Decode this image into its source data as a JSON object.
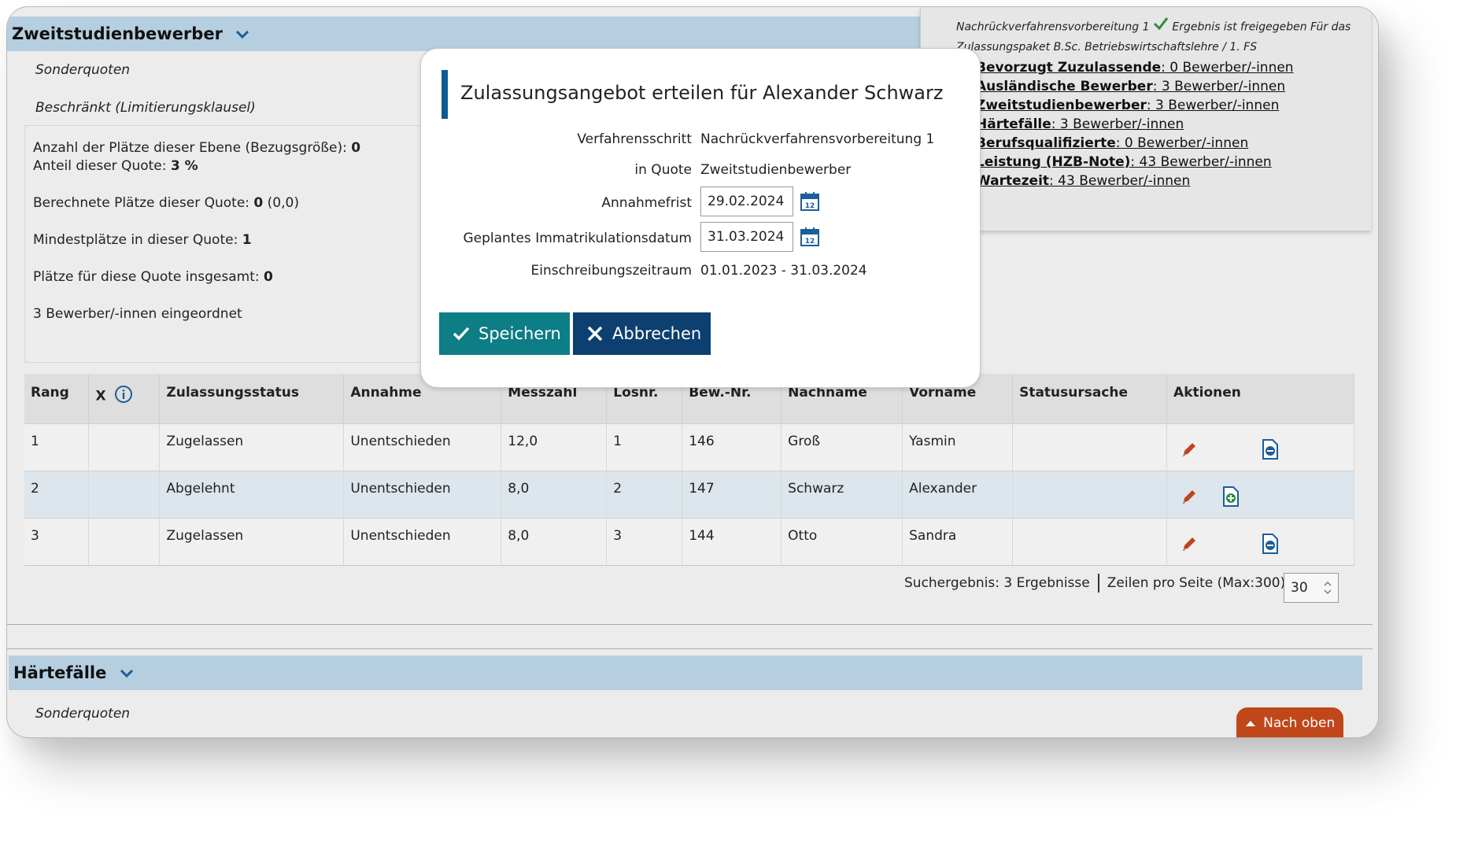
{
  "section1": {
    "title": "Zweitstudienbewerber",
    "sonderquoten": "Sonderquoten",
    "beschraenkt": "Beschränkt (Limitierungsklausel)",
    "info": {
      "plaetze_label": "Anzahl der Plätze dieser Ebene (Bezugsgröße): ",
      "plaetze_value": "0",
      "anteil_label": "Anteil dieser Quote: ",
      "anteil_value": "3 %",
      "berechnet_label": "Berechnete Plätze dieser Quote: ",
      "berechnet_value": "0",
      "berechnet_extra": " (0,0)",
      "mindest_label": "Mindestplätze in dieser Quote: ",
      "mindest_value": "1",
      "insgesamt_label": "Plätze für diese Quote insgesamt: ",
      "insgesamt_value": "0",
      "eingeordnet": "3 Bewerber/-innen eingeordnet"
    }
  },
  "right_panel": {
    "head_part1": "Nachrückverfahrensvorbereitung 1",
    "head_part2": "Ergebnis ist freigegeben Für das",
    "head_line2": "Zulassungspaket B.Sc. Betriebswirtschaftslehre / 1. FS",
    "items": [
      {
        "name": "Bevorzugt Zuzulassende",
        "count": ": 0 Bewerber/-innen"
      },
      {
        "name": "Ausländische Bewerber",
        "count": ": 3 Bewerber/-innen"
      },
      {
        "name": "Zweitstudienbewerber",
        "count": ": 3 Bewerber/-innen"
      },
      {
        "name": "Härtefälle",
        "count": ": 3 Bewerber/-innen"
      },
      {
        "name": "Berufsqualifizierte",
        "count": ": 0 Bewerber/-innen"
      },
      {
        "name": "Leistung (HZB-Note)",
        "count": ": 43 Bewerber/-innen"
      },
      {
        "name": "Wartezeit",
        "count": ": 43 Bewerber/-innen"
      }
    ]
  },
  "table": {
    "headers": [
      "Rang",
      "X",
      "Zulassungsstatus",
      "Annahme",
      "Messzahl",
      "Losnr.",
      "Bew.-Nr.",
      "Nachname",
      "Vorname",
      "Statusursache",
      "Aktionen"
    ],
    "rows": [
      {
        "rang": "1",
        "x": "",
        "status": "Zugelassen",
        "annahme": "Unentschieden",
        "messzahl": "12,0",
        "losnr": "1",
        "bewnr": "146",
        "nachname": "Groß",
        "vorname": "Yasmin",
        "statusursache": ""
      },
      {
        "rang": "2",
        "x": "",
        "status": "Abgelehnt",
        "annahme": "Unentschieden",
        "messzahl": "8,0",
        "losnr": "2",
        "bewnr": "147",
        "nachname": "Schwarz",
        "vorname": "Alexander",
        "statusursache": ""
      },
      {
        "rang": "3",
        "x": "",
        "status": "Zugelassen",
        "annahme": "Unentschieden",
        "messzahl": "8,0",
        "losnr": "3",
        "bewnr": "144",
        "nachname": "Otto",
        "vorname": "Sandra",
        "statusursache": ""
      }
    ]
  },
  "pager": {
    "result": "Suchergebnis: 3 Ergebnisse",
    "rows_label": "Zeilen pro Seite (Max:300)",
    "rows_value": "30"
  },
  "section2": {
    "title": "Härtefälle",
    "sonderquoten": "Sonderquoten"
  },
  "nach_oben": "Nach oben",
  "modal": {
    "title": "Zulassungsangebot erteilen für Alexander Schwarz",
    "fields": {
      "verfahren_label": "Verfahrensschritt",
      "verfahren_value": "Nachrückverfahrensvorbereitung 1",
      "quote_label": "in Quote",
      "quote_value": "Zweitstudienbewerber",
      "annahme_label": "Annahmefrist",
      "annahme_value": "29.02.2024",
      "immatrikulation_label": "Geplantes Immatrikulationsdatum",
      "immatrikulation_value": "31.03.2024",
      "einschreibung_label": "Einschreibungszeitraum",
      "einschreibung_value": "01.01.2023 - 31.03.2024"
    },
    "save": "Speichern",
    "cancel": "Abbrechen"
  },
  "colors": {
    "section_header": "#b5cfe0",
    "save_button": "#0d7d86",
    "cancel_button": "#0d3f70",
    "nach_oben": "#c0471a",
    "edit_icon": "#c0441a",
    "doc_icon": "#1b5e9a",
    "add_icon": "#2e8b3a"
  },
  "icons": [
    "chevron-down-icon",
    "check-icon",
    "info-icon",
    "pencil-icon",
    "document-icon",
    "document-add-icon",
    "calendar-icon",
    "close-icon",
    "arrow-up-icon"
  ]
}
